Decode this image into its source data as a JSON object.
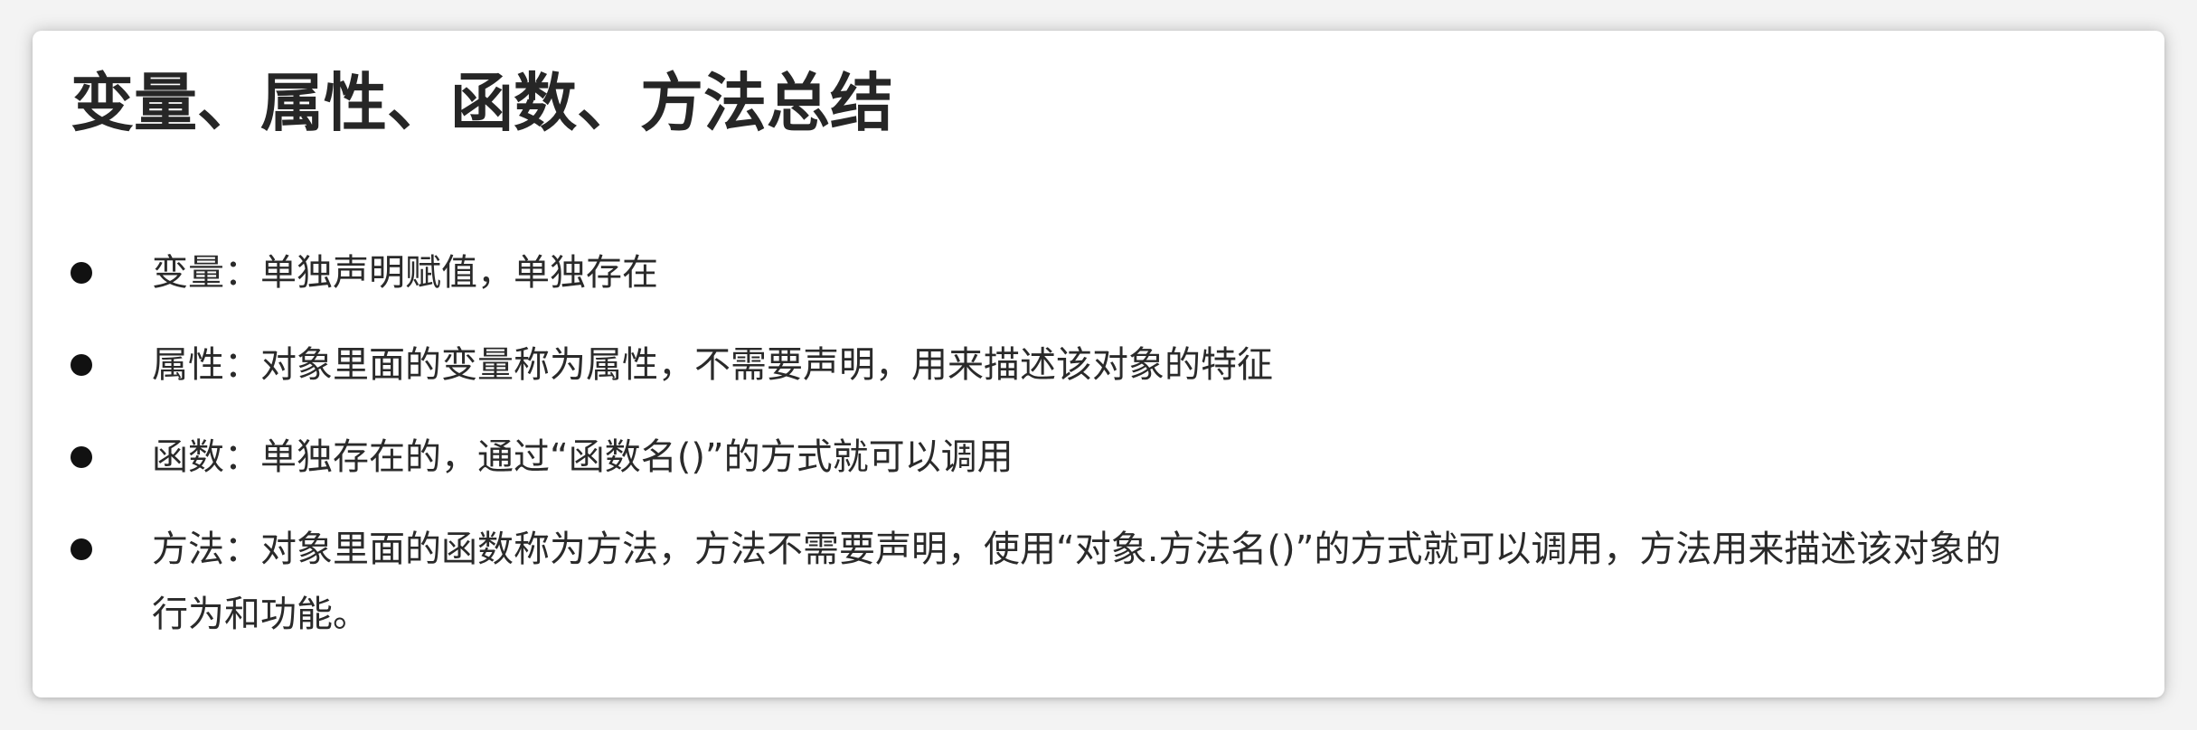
{
  "page": {
    "title": "变量、属性、函数、方法总结",
    "items": [
      {
        "text": "变量：单独声明赋值，单独存在"
      },
      {
        "text": "属性：对象里面的变量称为属性，不需要声明，用来描述该对象的特征"
      },
      {
        "text": "函数：单独存在的，通过“函数名()”的方式就可以调用"
      },
      {
        "text": "方法：对象里面的函数称为方法，方法不需要声明，使用“对象.方法名()”的方式就可以调用，方法用来描述该对象的行为和功能。"
      }
    ]
  },
  "colors": {
    "background": "#f3f3f3",
    "card": "#ffffff",
    "title": "#262626",
    "text": "#2a2a2a",
    "bullet": "#111111"
  },
  "icons": {
    "bullet": "filled-circle-bullet-icon"
  }
}
